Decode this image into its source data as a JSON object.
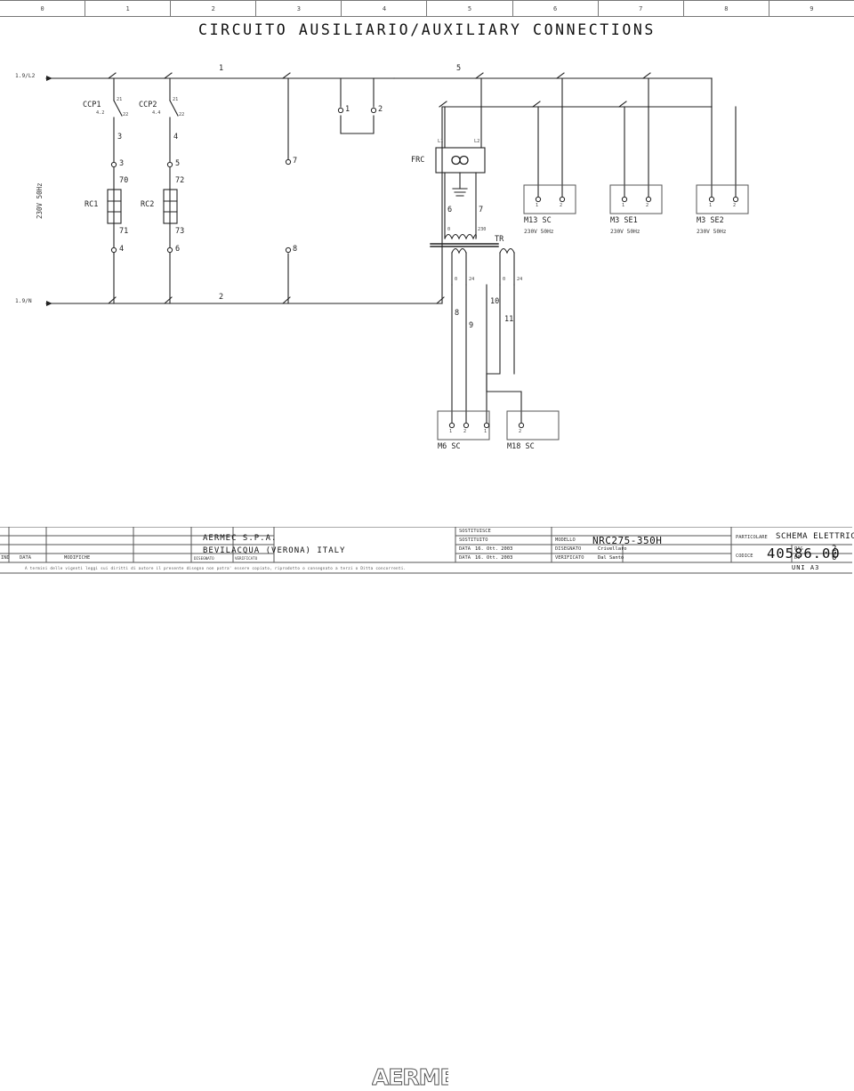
{
  "sheet": {
    "title": "CIRCUITO AUSILIARIO/AUXILIARY CONNECTIONS",
    "ruler": [
      "0",
      "1",
      "2",
      "3",
      "4",
      "5",
      "6",
      "7",
      "8",
      "9"
    ],
    "standard": "UNI A3"
  },
  "supply": {
    "line_ref": "1.9/L2",
    "neutral_ref": "1.9/N",
    "voltage": "230V 50Hz"
  },
  "contacts": [
    {
      "name": "CCP1",
      "xref": "4.2",
      "top_terminal": "21",
      "bottom_terminal": "22",
      "wire_below": "3"
    },
    {
      "name": "CCP2",
      "xref": "4.4",
      "top_terminal": "21",
      "bottom_terminal": "22",
      "wire_below": "4"
    }
  ],
  "relays": [
    {
      "name": "RC1",
      "terminal_top": "3",
      "wire_top": "70",
      "wire_bottom": "71",
      "terminal_bottom": "4"
    },
    {
      "name": "RC2",
      "terminal_top": "5",
      "wire_top": "72",
      "wire_bottom": "73",
      "terminal_bottom": "6"
    }
  ],
  "rail_labels": {
    "top_left": "1",
    "top_mid": "5",
    "bottom_left": "2"
  },
  "terminals": [
    {
      "id": "1"
    },
    {
      "id": "2"
    },
    {
      "id": "7"
    },
    {
      "id": "8"
    }
  ],
  "filter": {
    "name": "FRC",
    "in_left": "L1",
    "in_right": "L2",
    "out_left": "6",
    "out_right": "7",
    "symbol": "infinity"
  },
  "transformer": {
    "name": "TR",
    "primary": {
      "left": "0",
      "right": "230"
    },
    "secondary_a": {
      "left": "0",
      "right": "24",
      "wire_left": "8",
      "wire_right": "9"
    },
    "secondary_b": {
      "left": "0",
      "right": "24",
      "wire_left": "10",
      "wire_right": "11"
    }
  },
  "loads_top": [
    {
      "name": "M13 SC",
      "rating": "230V 50Hz",
      "t1": "1",
      "t2": "2"
    },
    {
      "name": "M3 SE1",
      "rating": "230V 50Hz",
      "t1": "1",
      "t2": "2"
    },
    {
      "name": "M3 SE2",
      "rating": "230V 50Hz",
      "t1": "1",
      "t2": "2"
    }
  ],
  "loads_bottom": [
    {
      "name": "M6 SC",
      "t1": "1",
      "t2": "2"
    },
    {
      "name": "M18 SC",
      "t1": "1",
      "t2": "2"
    }
  ],
  "revision_table": {
    "headers": [
      "IND",
      "DATA",
      "MODIFICHE",
      "DISEGNATO",
      "VERIFICATO"
    ]
  },
  "company": {
    "name": "AERMEC S.P.A.",
    "address": "BEVILACQUA (VERONA) ITALY",
    "logo": "AERMEC"
  },
  "titleblock": {
    "sostituisce_label": "SOSTITUISCE",
    "sostituito_label": "SOSTITUITO",
    "modello_label": "MODELLO",
    "modello_value": "NRC275-350H",
    "data1_label": "DATA",
    "data1_value": "16. Ott. 2003",
    "disegnato_label": "DISEGNATO",
    "disegnato_value": "Crivellaro",
    "data2_label": "DATA",
    "data2_value": "16. Ott. 2003",
    "verificato_label": "VERIFICATO",
    "verificato_value": "Dal Santo",
    "particolare_label": "PARTICOLARE",
    "particolare_value": "SCHEMA ELETTRICO",
    "codice_label": "CODICE",
    "codice_value": "40586.00",
    "pag_label": "PAG",
    "pag_value": "2",
    "di_label": "DI",
    "di_value": "6"
  },
  "disclaimer": "A termini delle vigenti leggi sui diritti di autore il presente disegno non potra' essere copiato, riprodotto o consegnato a terzi o Ditta concorrenti."
}
